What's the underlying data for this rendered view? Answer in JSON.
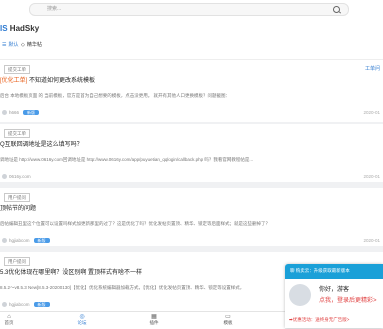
{
  "search": {
    "placeholder": "搜索..."
  },
  "header": {
    "site_prefix": "IS",
    "site_name": "HadSky",
    "links": [
      {
        "label": "默认",
        "icon": "list-icon"
      },
      {
        "label": "精华帖",
        "icon": "diamond-icon"
      }
    ]
  },
  "posts": [
    {
      "tag": "提交工单",
      "title_highlight": "[优化工单]",
      "title_rest": "不知道如何更改系统模板",
      "excerpt": "后台 本地模板页面 的 当前模板，官方是首为自己想要的模板，点击没更用。 就开有其他人口更换模板？问题截图：",
      "author": "h666",
      "badge": "新版",
      "date": "2020-01",
      "topright": "工单问"
    },
    {
      "tag": "提交工单",
      "title_highlight": "",
      "title_rest": "Q互联回调地址是这么填写吗？",
      "excerpt": "调地址是 http://www.0616y.com回调地址是 http://www.0616y.com/app/puyuetian_qqlogin/callback.php 吗？我看官网教程帖是...",
      "author": "0616y.com",
      "badge": "",
      "date": "2020-01",
      "topright": ""
    },
    {
      "tag": "用户提问",
      "title_highlight": "",
      "title_rest": "顶帖节的问题",
      "excerpt": "后帖编辑丑里这个位置可以设置吗样式加更新那里的过了？这是优化了吗？优化发帖页置顶、精华、锁定等后面样式；就是这些删掉了？",
      "author": "hgjiabcom",
      "badge": "新版",
      "date": "2020-01",
      "topright": ""
    },
    {
      "tag": "用户提问",
      "title_highlight": "",
      "title_rest": "5.3优化体现在哪里啊？没区别啊 置顶样式有啥不一样",
      "excerpt": "8.5.2～v8.5.3 New[8.5.3-20200130]【优化】优化系统编辑器加载方式，【优化】优化发帖页置顶、精华、锁定等设置样式，",
      "author": "hgjiabcom",
      "badge": "新版",
      "date": "2020-01",
      "topright": ""
    }
  ],
  "chat": {
    "header": "聊 购卖云：升级获取最新版本",
    "greeting": "你好，游客",
    "login_prompt": "点我，登录后更精彩>",
    "promo": "➡优惠活动：送终身无广告版>"
  },
  "bottom_nav": [
    {
      "label": "首页",
      "icon": "home-icon"
    },
    {
      "label": "论坛",
      "icon": "forum-icon"
    },
    {
      "label": "插件",
      "icon": "grid-icon"
    },
    {
      "label": "模板",
      "icon": "template-icon"
    }
  ],
  "colors": {
    "accent": "#2f7bd1",
    "highlight": "#e8601c",
    "chat_header": "#1aa0d8",
    "alert": "#e04040"
  }
}
